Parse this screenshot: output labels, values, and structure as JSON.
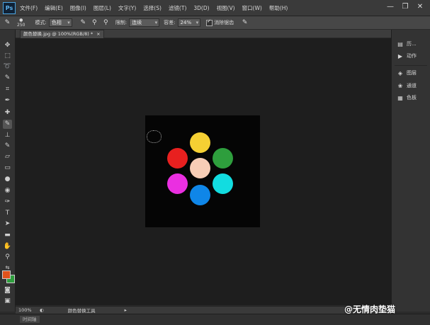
{
  "app": {
    "logo": "Ps"
  },
  "menu": [
    "文件(F)",
    "编辑(E)",
    "图像(I)",
    "图层(L)",
    "文字(Y)",
    "选择(S)",
    "滤镜(T)",
    "3D(D)",
    "视图(V)",
    "窗口(W)",
    "帮助(H)"
  ],
  "window_controls": {
    "minimize": "—",
    "restore": "❐",
    "close": "✕"
  },
  "options": {
    "brush_size": "250",
    "mode_label": "模式:",
    "mode_value": "色相",
    "limit_label": "限制:",
    "limit_value": "连续",
    "tolerance_label": "容差:",
    "tolerance_value": "24%",
    "antialias_label": "消除锯齿"
  },
  "document": {
    "tab_title": "颜色替换.jpg @ 100%(RGB/8) *"
  },
  "canvas": {
    "background": "#050505",
    "circles": [
      {
        "color": "#f5d033"
      },
      {
        "color": "#e8201f"
      },
      {
        "color": "#2e9e3d"
      },
      {
        "color": "#f7cdb6"
      },
      {
        "color": "#ea2fe1"
      },
      {
        "color": "#12dce0"
      },
      {
        "color": "#0f86e8"
      }
    ]
  },
  "panels": {
    "items": [
      {
        "icon": "history-icon",
        "label": "历..."
      },
      {
        "icon": "actions-icon",
        "label": "动作"
      },
      {
        "icon": "layers-icon",
        "label": "图层"
      },
      {
        "icon": "channels-icon",
        "label": "通道"
      },
      {
        "icon": "swatches-icon",
        "label": "色板"
      }
    ]
  },
  "colors": {
    "foreground": "#e0521c",
    "background": "#2e9e3d"
  },
  "status": {
    "zoom": "100%",
    "tool_name": "颜色替换工具"
  },
  "bottom": {
    "timeline_label": "时间轴"
  },
  "watermark": "@无情肉垫猫"
}
